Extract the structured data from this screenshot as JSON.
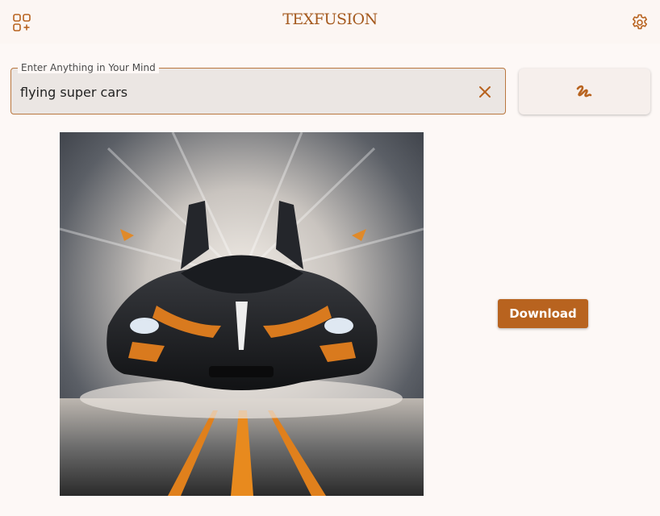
{
  "app": {
    "title": "TEXFUSION"
  },
  "header": {
    "left_icon": "apps-add-icon",
    "right_icon": "gear-icon"
  },
  "prompt": {
    "label": "Enter Anything in Your Mind",
    "value": "flying super cars",
    "clear_icon": "close-icon"
  },
  "generate_button": {
    "icon": "generate-squiggle-icon"
  },
  "result": {
    "image_subject": "black and orange supercar with open wing doors on a motion-blurred road"
  },
  "download_button": {
    "label": "Download"
  },
  "colors": {
    "accent": "#b8631f",
    "brand_text": "#a55a1f",
    "background": "#fdf8f6",
    "field_fill": "#ebe6e3"
  }
}
